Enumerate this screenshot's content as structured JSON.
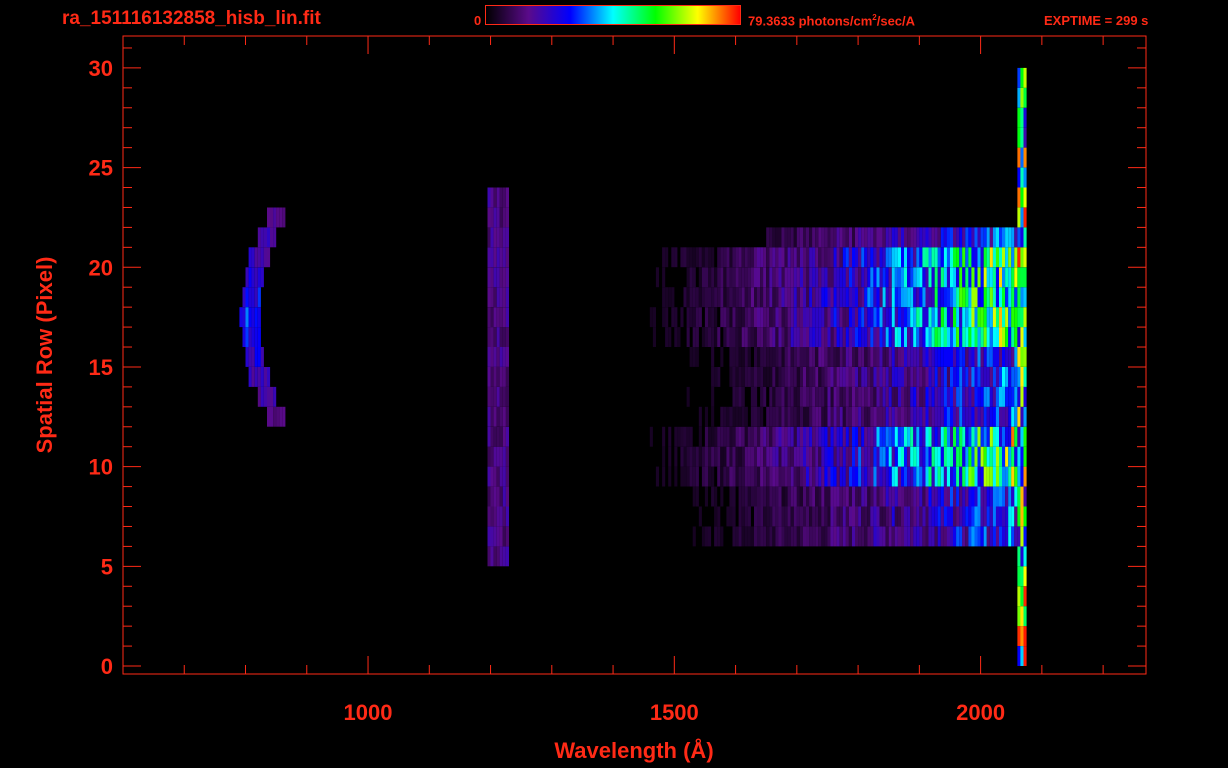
{
  "header": {
    "file_title": "ra_151116132858_hisb_lin.fit",
    "colorbar_min": "0",
    "colorbar_max_value": "79.3633",
    "colorbar_max_unit_prefix": " photons/cm",
    "colorbar_max_unit_sup": "2",
    "colorbar_max_unit_suffix": "/sec/A",
    "exptime": "EXPTIME = 299 s"
  },
  "colors": {
    "axis": "#ff2a16",
    "background": "#000000",
    "colormap": [
      "#000000",
      "#5a0a8a",
      "#0000ff",
      "#00ffff",
      "#00ff00",
      "#ffff00",
      "#ff0000"
    ]
  },
  "chart_data": {
    "type": "heatmap",
    "title": "ra_151116132858_hisb_lin.fit",
    "xlabel": "Wavelength (Å)",
    "ylabel": "Spatial Row (Pixel)",
    "xlim": [
      600,
      2270
    ],
    "ylim": [
      -0.4,
      31.6
    ],
    "xticks": [
      1000,
      1500,
      2000
    ],
    "yticks": [
      0,
      5,
      10,
      15,
      20,
      25,
      30
    ],
    "x_minor_step": 100,
    "y_minor_step": 1,
    "colorbar": {
      "min": 0,
      "max": 79.3633,
      "unit": "photons/cm²/sec/A"
    },
    "features": [
      {
        "name": "arc-emission",
        "x_range": [
          790,
          870
        ],
        "y_range": [
          12,
          23
        ],
        "peak_intensity": 0.35
      },
      {
        "name": "line-1216",
        "x_range": [
          1195,
          1230
        ],
        "y_range": [
          5,
          24
        ],
        "peak_intensity": 0.2
      },
      {
        "name": "continuum",
        "x_range": [
          1300,
          2060
        ],
        "y_range": [
          6,
          22
        ],
        "peak_intensity": 0.55
      },
      {
        "name": "edge-spike",
        "x_range": [
          2060,
          2075
        ],
        "y_range": [
          0,
          30
        ],
        "peak_intensity": 1.0
      }
    ],
    "bright_rows": [
      9,
      10,
      11,
      16,
      17,
      18,
      19,
      20
    ]
  }
}
